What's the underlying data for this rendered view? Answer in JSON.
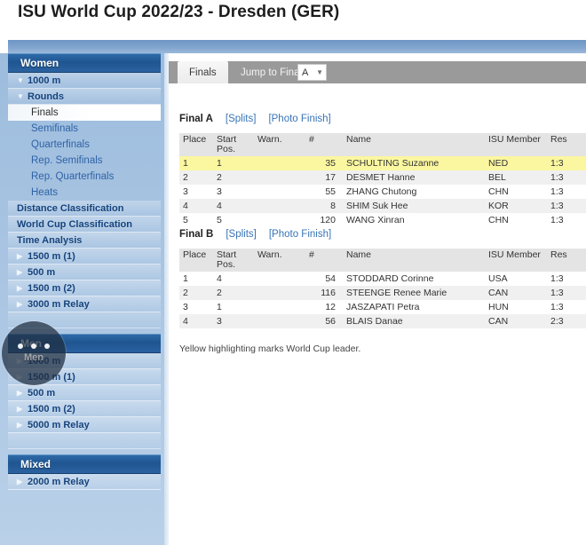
{
  "page": {
    "title": "ISU World Cup 2022/23 - Dresden (GER)"
  },
  "sidebar": {
    "sections": [
      {
        "name": "women-section",
        "header": "Women",
        "items": [
          {
            "label": "1000 m",
            "type": "item",
            "expanded": true
          },
          {
            "label": "Rounds",
            "type": "item",
            "expanded": true
          },
          {
            "label": "Finals",
            "type": "sub",
            "selected": true
          },
          {
            "label": "Semifinals",
            "type": "sub",
            "selected": false
          },
          {
            "label": "Quarterfinals",
            "type": "sub",
            "selected": false
          },
          {
            "label": "Rep. Semifinals",
            "type": "sub",
            "selected": false
          },
          {
            "label": "Rep. Quarterfinals",
            "type": "sub",
            "selected": false
          },
          {
            "label": "Heats",
            "type": "sub",
            "selected": false
          },
          {
            "label": "Distance Classification",
            "type": "plain"
          },
          {
            "label": "World Cup Classification",
            "type": "plain"
          },
          {
            "label": "Time Analysis",
            "type": "plain"
          },
          {
            "label": "1500 m (1)",
            "type": "item",
            "expanded": false
          },
          {
            "label": "500 m",
            "type": "item",
            "expanded": false
          },
          {
            "label": "1500 m (2)",
            "type": "item",
            "expanded": false
          },
          {
            "label": "3000 m Relay",
            "type": "item",
            "expanded": false
          }
        ]
      },
      {
        "name": "men-section",
        "header": "Men",
        "items": [
          {
            "label": "1000 m",
            "type": "item",
            "expanded": false
          },
          {
            "label": "1500 m (1)",
            "type": "item",
            "expanded": false
          },
          {
            "label": "500 m",
            "type": "item",
            "expanded": false
          },
          {
            "label": "1500 m (2)",
            "type": "item",
            "expanded": false
          },
          {
            "label": "5000 m Relay",
            "type": "item",
            "expanded": false
          }
        ]
      },
      {
        "name": "mixed-section",
        "header": "Mixed",
        "items": [
          {
            "label": "2000 m Relay",
            "type": "item",
            "expanded": false
          }
        ]
      }
    ]
  },
  "loader": {
    "label": "Men",
    "dots": 3
  },
  "tabs": {
    "active_label": "Finals",
    "jump_label": "Jump to Final",
    "dropdown_value": "A",
    "dropdown_chevron": "chevron-down-icon"
  },
  "content": {
    "columns": [
      "Place",
      "Start Pos.",
      "Warn.",
      "#",
      "Name",
      "ISU Member",
      "Res"
    ],
    "column_start_line1": "Start",
    "column_start_line2": "Pos.",
    "links": {
      "splits": "[Splits]",
      "photo_finish": "[Photo Finish]"
    },
    "sections": [
      {
        "title": "Final A",
        "rows": [
          {
            "place": "1",
            "start": "1",
            "warn": "",
            "num": "35",
            "name": "SCHULTING Suzanne",
            "isu": "NED",
            "res": "1:3",
            "leader": true
          },
          {
            "place": "2",
            "start": "2",
            "warn": "",
            "num": "17",
            "name": "DESMET Hanne",
            "isu": "BEL",
            "res": "1:3",
            "leader": false
          },
          {
            "place": "3",
            "start": "3",
            "warn": "",
            "num": "55",
            "name": "ZHANG Chutong",
            "isu": "CHN",
            "res": "1:3",
            "leader": false
          },
          {
            "place": "4",
            "start": "4",
            "warn": "",
            "num": "8",
            "name": "SHIM Suk Hee",
            "isu": "KOR",
            "res": "1:3",
            "leader": false
          },
          {
            "place": "5",
            "start": "5",
            "warn": "",
            "num": "120",
            "name": "WANG Xinran",
            "isu": "CHN",
            "res": "1:3",
            "leader": false
          }
        ]
      },
      {
        "title": "Final B",
        "rows": [
          {
            "place": "1",
            "start": "4",
            "warn": "",
            "num": "54",
            "name": "STODDARD Corinne",
            "isu": "USA",
            "res": "1:3",
            "leader": false
          },
          {
            "place": "2",
            "start": "2",
            "warn": "",
            "num": "116",
            "name": "STEENGE Renee Marie",
            "isu": "CAN",
            "res": "1:3",
            "leader": false
          },
          {
            "place": "3",
            "start": "1",
            "warn": "",
            "num": "12",
            "name": "JASZAPATI Petra",
            "isu": "HUN",
            "res": "1:3",
            "leader": false
          },
          {
            "place": "4",
            "start": "3",
            "warn": "",
            "num": "56",
            "name": "BLAIS Danae",
            "isu": "CAN",
            "res": "2:3",
            "leader": false
          }
        ]
      }
    ],
    "note": "Yellow highlighting marks World Cup leader."
  }
}
